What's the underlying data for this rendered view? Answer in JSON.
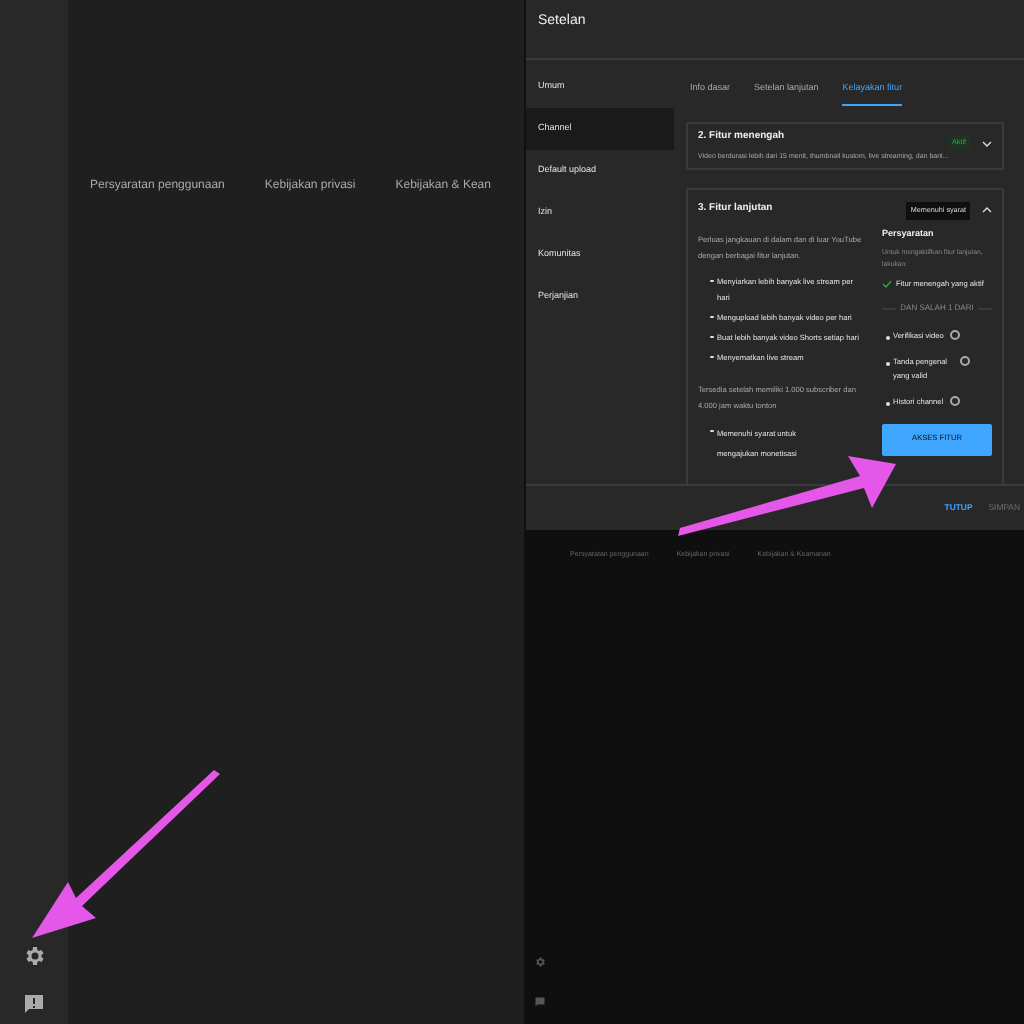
{
  "left_screen": {
    "footer_links": [
      "Persyaratan penggunaan",
      "Kebijakan privasi",
      "Kebijakan & Kean"
    ]
  },
  "dialog": {
    "title": "Setelan",
    "nav": [
      {
        "label": "Umum",
        "selected": false
      },
      {
        "label": "Channel",
        "selected": true
      },
      {
        "label": "Default upload",
        "selected": false
      },
      {
        "label": "Izin",
        "selected": false
      },
      {
        "label": "Komunitas",
        "selected": false
      },
      {
        "label": "Perjanjian",
        "selected": false
      }
    ],
    "tabs": [
      {
        "label": "Info dasar",
        "selected": false
      },
      {
        "label": "Setelan lanjutan",
        "selected": false
      },
      {
        "label": "Kelayakan fitur",
        "selected": true
      }
    ],
    "intermediate_card": {
      "title": "2. Fitur menengah",
      "description": "Video berdurasi lebih dari 15 menit, thumbnail kustom, live streaming, dan banl...",
      "badge": "Aktif",
      "expanded": false
    },
    "advanced_card": {
      "title": "3. Fitur lanjutan",
      "badge": "Memenuhi syarat",
      "expanded": true,
      "intro": "Perluas jangkauan di dalam dan di luar YouTube dengan berbagai fitur lanjutan.",
      "features": [
        "Menyiarkan lebih banyak live stream per hari",
        "Mengupload lebih banyak video per hari",
        "Buat lebih banyak video Shorts setiap hari",
        "Menyematkan live stream"
      ],
      "note": "Tersedia setelah memiliki 1.000 subscriber dan 4.000 jam waktu tonton",
      "note_items": [
        "Memenuhi syarat untuk mengajukan monetisasi"
      ],
      "requirements_title": "Persyaratan",
      "requirements_description": "Untuk mengaktifkan fitur lanjutan, lakukan:",
      "met_requirement": "Fitur menengah yang aktif",
      "divider_label": "DAN SALAH 1 DARI",
      "options": [
        "Verifikasi video",
        "Tanda pengenal yang valid",
        "Histori channel"
      ],
      "action": "AKSES FITUR"
    },
    "buttons": [
      {
        "label": "TUTUP",
        "kind": "primary"
      },
      {
        "label": "SIMPAN",
        "kind": "disabled"
      }
    ]
  },
  "right_screen": {
    "footer_links": [
      "Persyaratan penggunaan",
      "Kebijakan privasi",
      "Kebijakan & Keamanan"
    ]
  }
}
